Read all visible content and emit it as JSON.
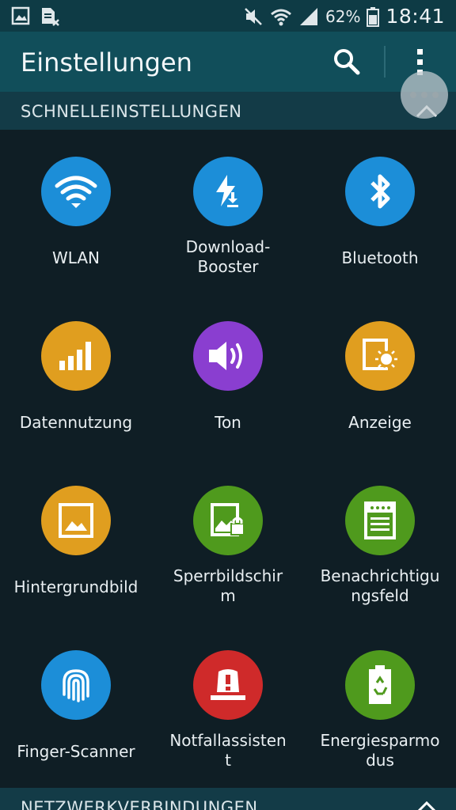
{
  "status_bar": {
    "battery_percent": "62%",
    "time": "18:41",
    "icons": [
      "gallery-notification-icon",
      "sim-notification-icon",
      "mute-icon",
      "wifi-icon",
      "signal-icon",
      "battery-icon"
    ]
  },
  "app_bar": {
    "title": "Einstellungen",
    "icons": [
      "search-icon",
      "overflow-menu-icon"
    ]
  },
  "sections": [
    {
      "title": "SCHNELLEINSTELLUNGEN",
      "expanded": true
    },
    {
      "title": "NETZWERKVERBINDUNGEN",
      "expanded": true
    }
  ],
  "quick_settings": [
    {
      "label": "WLAN",
      "icon": "wifi-icon",
      "color": "#1c8ed8"
    },
    {
      "label": "Download-\nBooster",
      "icon": "download-booster-icon",
      "color": "#1c8ed8"
    },
    {
      "label": "Bluetooth",
      "icon": "bluetooth-icon",
      "color": "#1c8ed8"
    },
    {
      "label": "Datennutzung",
      "icon": "data-usage-icon",
      "color": "#e09e1f"
    },
    {
      "label": "Ton",
      "icon": "speaker-icon",
      "color": "#8a3ed0"
    },
    {
      "label": "Anzeige",
      "icon": "display-icon",
      "color": "#e09e1f"
    },
    {
      "label": "Hintergrundbild",
      "icon": "wallpaper-icon",
      "color": "#e09e1f"
    },
    {
      "label": "Sperrbildschir\nm",
      "icon": "lock-screen-icon",
      "color": "#4f9a1d"
    },
    {
      "label": "Benachrichtigu\nngsfeld",
      "icon": "notification-panel-icon",
      "color": "#4f9a1d"
    },
    {
      "label": "Finger-Scanner",
      "icon": "fingerprint-icon",
      "color": "#1c8ed8"
    },
    {
      "label": "Notfallassisten\nt",
      "icon": "emergency-icon",
      "color": "#cf2a2a"
    },
    {
      "label": "Energiesparmo\ndus",
      "icon": "power-saving-icon",
      "color": "#4f9a1d"
    }
  ]
}
